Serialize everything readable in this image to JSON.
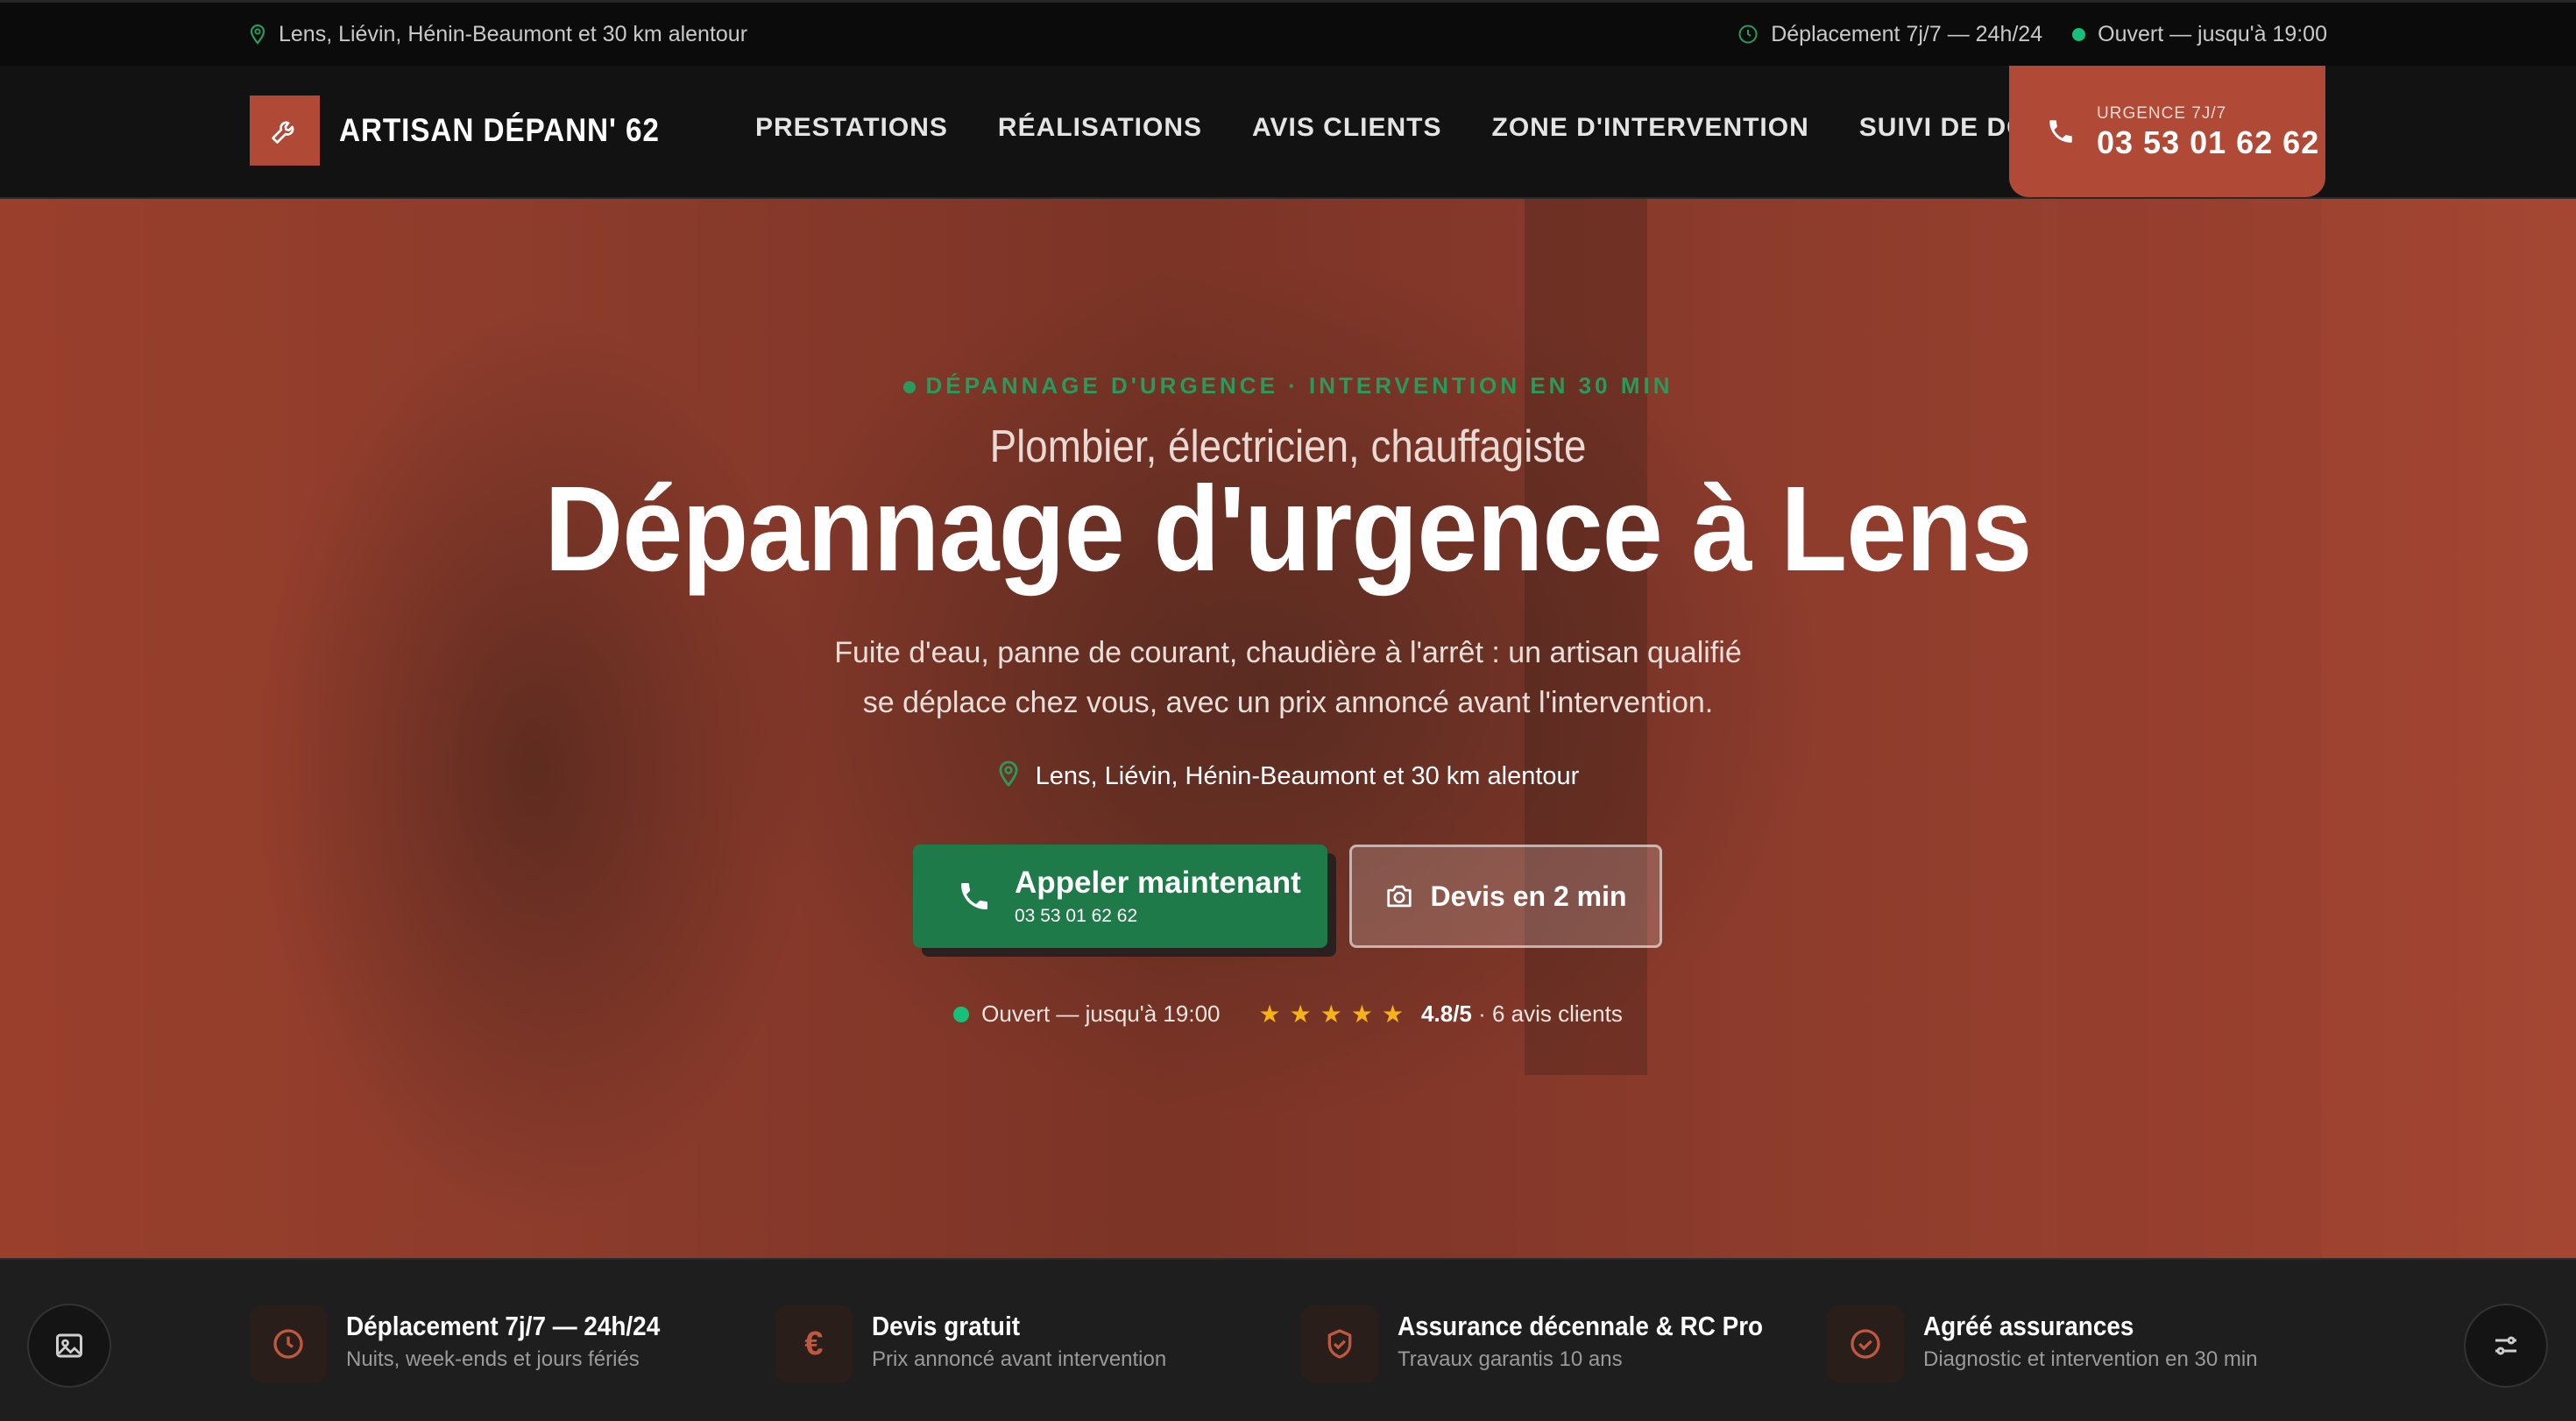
{
  "topbar": {
    "location": "Lens, Liévin, Hénin-Beaumont et 30 km alentour",
    "hours": "Déplacement 7j/7 — 24h/24",
    "open_status": "Ouvert — jusqu'à 19:00"
  },
  "header": {
    "brand": "ARTISAN DÉPANN' 62",
    "nav": [
      "PRESTATIONS",
      "RÉALISATIONS",
      "AVIS CLIENTS",
      "ZONE D'INTERVENTION",
      "SUIVI DE DOSSIER"
    ],
    "urgence_label": "URGENCE 7J/7",
    "urgence_phone": "03 53 01 62 62"
  },
  "hero": {
    "kicker": "DÉPANNAGE D'URGENCE · INTERVENTION EN 30 MIN",
    "subtitle": "Plombier, électricien, chauffagiste",
    "title": "Dépannage d'urgence à Lens",
    "desc_line1": "Fuite d'eau, panne de courant, chaudière à l'arrêt : un artisan qualifié",
    "desc_line2": "se déplace chez vous, avec un prix annoncé avant l'intervention.",
    "area": "Lens, Liévin, Hénin-Beaumont et 30 km alentour",
    "call_label": "Appeler maintenant",
    "call_phone": "03 53 01 62 62",
    "quote_label": "Devis en 2 min",
    "open_status": "Ouvert — jusqu'à 19:00",
    "rating_score": "4.8/5",
    "rating_count": " · 6 avis clients",
    "rating_stars": 5
  },
  "features": [
    {
      "title": "Déplacement 7j/7 — 24h/24",
      "sub": "Nuits, week-ends et jours fériés",
      "icon": "clock-icon"
    },
    {
      "title": "Devis gratuit",
      "sub": "Prix annoncé avant intervention",
      "icon": "euro-icon"
    },
    {
      "title": "Assurance décennale & RC Pro",
      "sub": "Travaux garantis 10 ans",
      "icon": "shield-check-icon"
    },
    {
      "title": "Agréé assurances",
      "sub": "Diagnostic et intervention en 30 min",
      "icon": "check-circle-icon"
    }
  ],
  "colors": {
    "accent": "#b04a36",
    "green": "#1f7a4a",
    "status": "#17c07a",
    "star": "#f5b319"
  }
}
